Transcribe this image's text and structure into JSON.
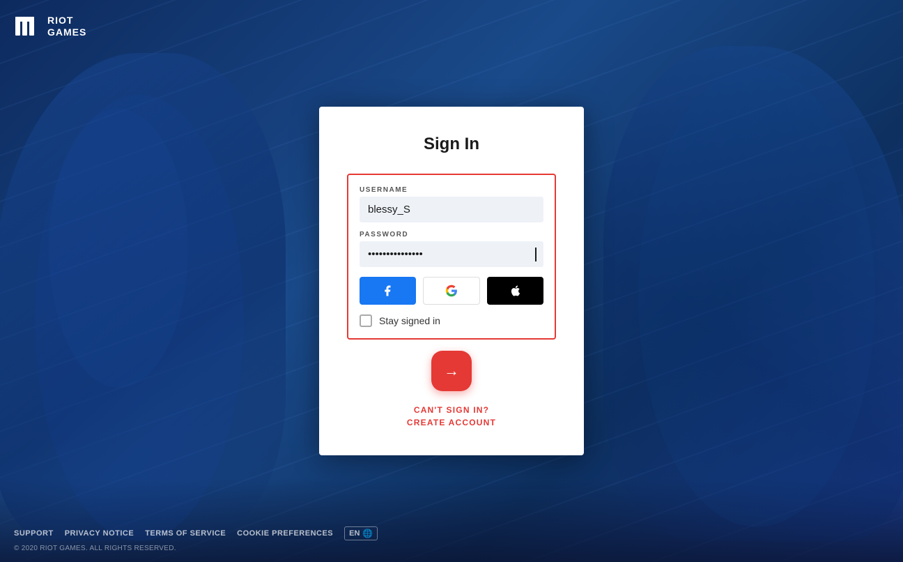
{
  "logo": {
    "line1": "RIOT",
    "line2": "GAMES"
  },
  "modal": {
    "title": "Sign In",
    "username_label": "USERNAME",
    "username_value": "blessy_S",
    "password_label": "PASSWORD",
    "password_value": "••••••••••••",
    "stay_signed_label": "Stay signed in",
    "cant_sign_in": "CAN'T SIGN IN?",
    "create_account": "CREATE ACCOUNT"
  },
  "social": {
    "facebook_label": "f",
    "google_label": "G",
    "apple_label": ""
  },
  "footer": {
    "support": "SUPPORT",
    "privacy": "PRIVACY NOTICE",
    "terms": "TERMS OF SERVICE",
    "cookies": "COOKIE PREFERENCES",
    "lang": "EN",
    "copyright": "© 2020 RIOT GAMES. ALL RIGHTS RESERVED."
  }
}
